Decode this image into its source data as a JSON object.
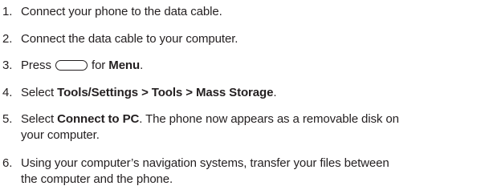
{
  "steps": [
    {
      "number": "1.",
      "text": "Connect your phone to the data cable."
    },
    {
      "number": "2.",
      "text": "Connect the data cable to your computer."
    },
    {
      "number": "3.",
      "before": "Press",
      "icon": "menu-softkey-icon",
      "after": "for",
      "bold": "Menu",
      "end": "."
    },
    {
      "number": "4.",
      "before": "Select",
      "bold": "Tools/Settings > Tools > Mass Storage",
      "end": "."
    },
    {
      "number": "5.",
      "before": "Select",
      "bold": "Connect to PC",
      "after_line1": ". The phone now appears as a removable disk on",
      "line2": "your computer."
    },
    {
      "number": "6.",
      "line1": "Using your computer’s navigation systems, transfer your files between",
      "line2": "the computer and the phone."
    }
  ]
}
